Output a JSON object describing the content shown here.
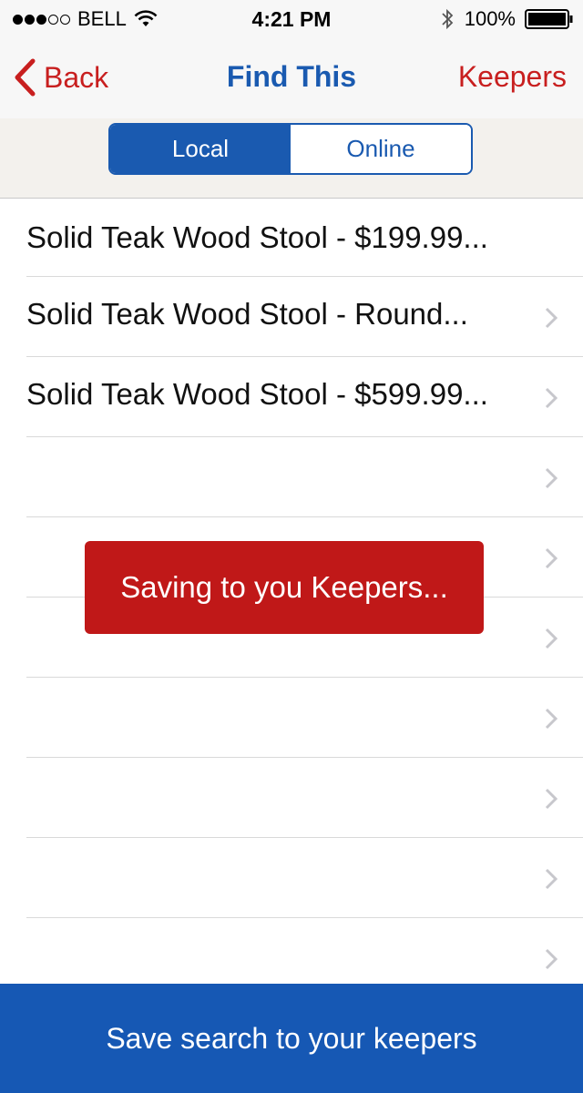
{
  "status_bar": {
    "carrier": "BELL",
    "time": "4:21 PM",
    "battery": "100%"
  },
  "nav": {
    "back_label": "Back",
    "title": "Find This",
    "keepers_label": "Keepers"
  },
  "segments": {
    "local": "Local",
    "online": "Online",
    "selected": "Local"
  },
  "colors": {
    "accent_blue": "#1a5ab0",
    "accent_red": "#c81f1f",
    "toast_red": "#c01818"
  },
  "list": {
    "items": [
      {
        "label": "Solid Teak Wood Stool - $199.99..."
      },
      {
        "label": "Solid Teak Wood Stool - Round..."
      },
      {
        "label": "Solid Teak Wood Stool - $599.99..."
      },
      {
        "label": ""
      },
      {
        "label": ""
      },
      {
        "label": ""
      },
      {
        "label": ""
      },
      {
        "label": ""
      },
      {
        "label": ""
      },
      {
        "label": ""
      }
    ]
  },
  "toast": {
    "message": "Saving to you Keepers..."
  },
  "bottom": {
    "save_label": "Save search to your keepers"
  }
}
